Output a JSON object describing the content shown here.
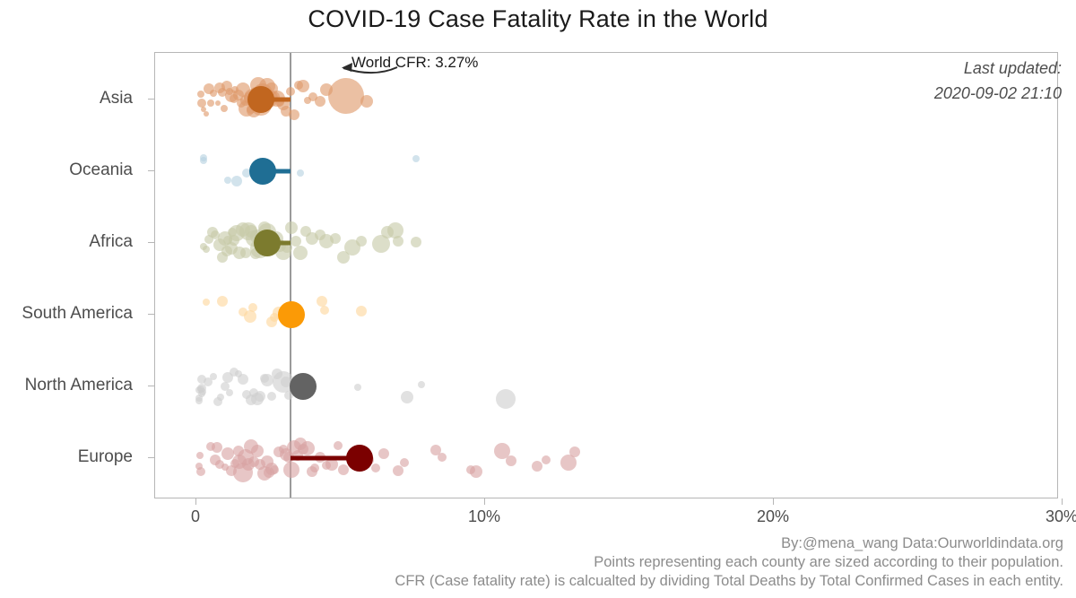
{
  "chart_data": {
    "type": "scatter",
    "title": "COVID-19 Case Fatality Rate in the World",
    "xlabel": "",
    "ylabel": "",
    "xlim": [
      -1.2,
      30.8
    ],
    "xticks": [
      0,
      10,
      20,
      30
    ],
    "xtick_labels": [
      "0",
      "10%",
      "20%",
      "30%"
    ],
    "grid": false,
    "legend": "none",
    "categories": [
      "Asia",
      "Oceania",
      "Africa",
      "South America",
      "North America",
      "Europe"
    ],
    "reference_line": {
      "label": "World CFR: 3.27%",
      "value": 3.27,
      "color": "#9a9a9a"
    },
    "series": [
      {
        "name": "Asia",
        "color": "#C1661F",
        "point_color": "#DE9A6B",
        "mean": 2.25,
        "points": [
          {
            "x": 0.35,
            "r": 3
          },
          {
            "x": 0.6,
            "r": 4
          },
          {
            "x": 0.75,
            "r": 3
          },
          {
            "x": 0.9,
            "r": 5
          },
          {
            "x": 1.05,
            "r": 6
          },
          {
            "x": 1.15,
            "r": 4
          },
          {
            "x": 1.2,
            "r": 7
          },
          {
            "x": 1.3,
            "r": 5
          },
          {
            "x": 1.35,
            "r": 4
          },
          {
            "x": 1.45,
            "r": 6
          },
          {
            "x": 0.45,
            "r": 6
          },
          {
            "x": 0.5,
            "r": 4
          },
          {
            "x": 0.2,
            "r": 5
          },
          {
            "x": 0.15,
            "r": 4
          },
          {
            "x": 0.8,
            "r": 6
          },
          {
            "x": 1.6,
            "r": 8
          },
          {
            "x": 1.7,
            "r": 6
          },
          {
            "x": 1.75,
            "r": 9
          },
          {
            "x": 1.85,
            "r": 7
          },
          {
            "x": 1.9,
            "r": 5
          },
          {
            "x": 1.95,
            "r": 10
          },
          {
            "x": 2.0,
            "r": 8
          },
          {
            "x": 2.05,
            "r": 6
          },
          {
            "x": 2.15,
            "r": 9
          },
          {
            "x": 2.2,
            "r": 7
          },
          {
            "x": 2.3,
            "r": 11
          },
          {
            "x": 2.35,
            "r": 6
          },
          {
            "x": 2.4,
            "r": 8
          },
          {
            "x": 2.5,
            "r": 10
          },
          {
            "x": 2.6,
            "r": 7
          },
          {
            "x": 2.7,
            "r": 6
          },
          {
            "x": 2.8,
            "r": 9
          },
          {
            "x": 2.9,
            "r": 5
          },
          {
            "x": 3.0,
            "r": 7
          },
          {
            "x": 3.1,
            "r": 6
          },
          {
            "x": 3.25,
            "r": 5
          },
          {
            "x": 3.4,
            "r": 6
          },
          {
            "x": 3.55,
            "r": 5
          },
          {
            "x": 3.7,
            "r": 7
          },
          {
            "x": 4.05,
            "r": 5
          },
          {
            "x": 4.3,
            "r": 6
          },
          {
            "x": 4.5,
            "r": 7
          },
          {
            "x": 5.2,
            "r": 20
          },
          {
            "x": 5.9,
            "r": 7
          },
          {
            "x": 2.25,
            "r": 12
          },
          {
            "x": 2.45,
            "r": 9
          },
          {
            "x": 1.55,
            "r": 5
          },
          {
            "x": 0.95,
            "r": 4
          },
          {
            "x": 0.25,
            "r": 3
          },
          {
            "x": 3.85,
            "r": 4
          }
        ]
      },
      {
        "name": "Oceania",
        "color": "#1F6E94",
        "point_color": "#B6D2E0",
        "mean": 2.3,
        "points": [
          {
            "x": 0.25,
            "r": 4
          },
          {
            "x": 0.25,
            "r": 4
          },
          {
            "x": 1.1,
            "r": 4
          },
          {
            "x": 1.4,
            "r": 6
          },
          {
            "x": 1.75,
            "r": 5
          },
          {
            "x": 3.6,
            "r": 4
          },
          {
            "x": 7.6,
            "r": 4
          }
        ]
      },
      {
        "name": "Africa",
        "color": "#7C7B2E",
        "point_color": "#C7C9A8",
        "mean": 2.45,
        "points": [
          {
            "x": 0.35,
            "r": 4
          },
          {
            "x": 0.55,
            "r": 6
          },
          {
            "x": 0.65,
            "r": 5
          },
          {
            "x": 0.8,
            "r": 7
          },
          {
            "x": 0.9,
            "r": 6
          },
          {
            "x": 1.0,
            "r": 8
          },
          {
            "x": 1.1,
            "r": 5
          },
          {
            "x": 1.2,
            "r": 7
          },
          {
            "x": 1.3,
            "r": 6
          },
          {
            "x": 1.4,
            "r": 9
          },
          {
            "x": 1.5,
            "r": 7
          },
          {
            "x": 1.6,
            "r": 8
          },
          {
            "x": 1.7,
            "r": 6
          },
          {
            "x": 1.8,
            "r": 10
          },
          {
            "x": 1.9,
            "r": 7
          },
          {
            "x": 2.0,
            "r": 9
          },
          {
            "x": 2.1,
            "r": 8
          },
          {
            "x": 2.2,
            "r": 11
          },
          {
            "x": 2.35,
            "r": 7
          },
          {
            "x": 2.5,
            "r": 9
          },
          {
            "x": 2.6,
            "r": 6
          },
          {
            "x": 2.75,
            "r": 8
          },
          {
            "x": 2.9,
            "r": 7
          },
          {
            "x": 3.0,
            "r": 9
          },
          {
            "x": 3.15,
            "r": 6
          },
          {
            "x": 3.3,
            "r": 7
          },
          {
            "x": 3.45,
            "r": 6
          },
          {
            "x": 3.6,
            "r": 8
          },
          {
            "x": 3.8,
            "r": 6
          },
          {
            "x": 4.0,
            "r": 7
          },
          {
            "x": 4.3,
            "r": 6
          },
          {
            "x": 4.5,
            "r": 8
          },
          {
            "x": 4.8,
            "r": 6
          },
          {
            "x": 5.1,
            "r": 7
          },
          {
            "x": 5.4,
            "r": 9
          },
          {
            "x": 5.7,
            "r": 6
          },
          {
            "x": 6.4,
            "r": 10
          },
          {
            "x": 6.6,
            "r": 7
          },
          {
            "x": 6.9,
            "r": 9
          },
          {
            "x": 7.0,
            "r": 6
          },
          {
            "x": 7.6,
            "r": 6
          },
          {
            "x": 0.25,
            "r": 4
          },
          {
            "x": 0.45,
            "r": 5
          },
          {
            "x": 1.05,
            "r": 6
          },
          {
            "x": 1.25,
            "r": 5
          },
          {
            "x": 2.45,
            "r": 10
          },
          {
            "x": 2.05,
            "r": 6
          }
        ]
      },
      {
        "name": "South America",
        "color": "#FB9A06",
        "point_color": "#FDD79C",
        "mean": 3.3,
        "points": [
          {
            "x": 0.35,
            "r": 4
          },
          {
            "x": 0.9,
            "r": 6
          },
          {
            "x": 1.6,
            "r": 5
          },
          {
            "x": 1.85,
            "r": 7
          },
          {
            "x": 1.95,
            "r": 5
          },
          {
            "x": 2.6,
            "r": 6
          },
          {
            "x": 2.7,
            "r": 5
          },
          {
            "x": 2.85,
            "r": 7
          },
          {
            "x": 3.0,
            "r": 6
          },
          {
            "x": 3.1,
            "r": 5
          },
          {
            "x": 4.35,
            "r": 6
          },
          {
            "x": 4.45,
            "r": 5
          },
          {
            "x": 5.7,
            "r": 6
          }
        ]
      },
      {
        "name": "North America",
        "color": "#636363",
        "point_color": "#CFCFCF",
        "mean": 3.7,
        "points": [
          {
            "x": 0.1,
            "r": 4
          },
          {
            "x": 0.1,
            "r": 4
          },
          {
            "x": 0.1,
            "r": 4
          },
          {
            "x": 0.15,
            "r": 4
          },
          {
            "x": 0.18,
            "r": 5
          },
          {
            "x": 0.2,
            "r": 5
          },
          {
            "x": 0.2,
            "r": 4
          },
          {
            "x": 0.22,
            "r": 4
          },
          {
            "x": 0.4,
            "r": 5
          },
          {
            "x": 0.6,
            "r": 4
          },
          {
            "x": 0.75,
            "r": 5
          },
          {
            "x": 0.85,
            "r": 4
          },
          {
            "x": 1.0,
            "r": 5
          },
          {
            "x": 1.1,
            "r": 6
          },
          {
            "x": 1.15,
            "r": 4
          },
          {
            "x": 1.3,
            "r": 5
          },
          {
            "x": 1.45,
            "r": 4
          },
          {
            "x": 1.6,
            "r": 6
          },
          {
            "x": 1.75,
            "r": 5
          },
          {
            "x": 1.9,
            "r": 6
          },
          {
            "x": 2.0,
            "r": 5
          },
          {
            "x": 2.1,
            "r": 7
          },
          {
            "x": 2.2,
            "r": 6
          },
          {
            "x": 2.35,
            "r": 5
          },
          {
            "x": 2.45,
            "r": 7
          },
          {
            "x": 2.6,
            "r": 5
          },
          {
            "x": 2.8,
            "r": 6
          },
          {
            "x": 3.0,
            "r": 12
          },
          {
            "x": 3.1,
            "r": 6
          },
          {
            "x": 3.2,
            "r": 5
          },
          {
            "x": 5.6,
            "r": 4
          },
          {
            "x": 7.3,
            "r": 7
          },
          {
            "x": 7.8,
            "r": 4
          },
          {
            "x": 10.7,
            "r": 11
          }
        ]
      },
      {
        "name": "Europe",
        "color": "#7B0000",
        "point_color": "#D9A3A3",
        "mean": 5.65,
        "points": [
          {
            "x": 0.1,
            "r": 4
          },
          {
            "x": 0.12,
            "r": 4
          },
          {
            "x": 0.15,
            "r": 5
          },
          {
            "x": 0.5,
            "r": 5
          },
          {
            "x": 0.65,
            "r": 6
          },
          {
            "x": 0.7,
            "r": 6
          },
          {
            "x": 0.8,
            "r": 5
          },
          {
            "x": 1.0,
            "r": 4
          },
          {
            "x": 1.1,
            "r": 7
          },
          {
            "x": 1.2,
            "r": 6
          },
          {
            "x": 1.35,
            "r": 5
          },
          {
            "x": 1.5,
            "r": 8
          },
          {
            "x": 1.6,
            "r": 11
          },
          {
            "x": 1.7,
            "r": 9
          },
          {
            "x": 1.8,
            "r": 7
          },
          {
            "x": 1.9,
            "r": 8
          },
          {
            "x": 2.0,
            "r": 6
          },
          {
            "x": 2.1,
            "r": 7
          },
          {
            "x": 2.2,
            "r": 6
          },
          {
            "x": 2.35,
            "r": 8
          },
          {
            "x": 2.5,
            "r": 6
          },
          {
            "x": 2.6,
            "r": 7
          },
          {
            "x": 2.7,
            "r": 5
          },
          {
            "x": 2.85,
            "r": 6
          },
          {
            "x": 3.0,
            "r": 5
          },
          {
            "x": 3.1,
            "r": 7
          },
          {
            "x": 3.2,
            "r": 6
          },
          {
            "x": 3.4,
            "r": 8
          },
          {
            "x": 3.5,
            "r": 6
          },
          {
            "x": 3.6,
            "r": 7
          },
          {
            "x": 3.7,
            "r": 6
          },
          {
            "x": 3.85,
            "r": 8
          },
          {
            "x": 4.0,
            "r": 6
          },
          {
            "x": 4.1,
            "r": 5
          },
          {
            "x": 4.3,
            "r": 6
          },
          {
            "x": 4.5,
            "r": 5
          },
          {
            "x": 4.7,
            "r": 7
          },
          {
            "x": 4.9,
            "r": 5
          },
          {
            "x": 5.1,
            "r": 6
          },
          {
            "x": 5.95,
            "r": 6
          },
          {
            "x": 6.2,
            "r": 5
          },
          {
            "x": 6.5,
            "r": 6
          },
          {
            "x": 7.0,
            "r": 6
          },
          {
            "x": 7.2,
            "r": 5
          },
          {
            "x": 8.3,
            "r": 6
          },
          {
            "x": 8.5,
            "r": 5
          },
          {
            "x": 9.5,
            "r": 5
          },
          {
            "x": 9.7,
            "r": 7
          },
          {
            "x": 10.6,
            "r": 9
          },
          {
            "x": 10.9,
            "r": 6
          },
          {
            "x": 11.8,
            "r": 6
          },
          {
            "x": 12.1,
            "r": 5
          },
          {
            "x": 12.9,
            "r": 9
          },
          {
            "x": 13.1,
            "r": 6
          },
          {
            "x": 3.3,
            "r": 9
          },
          {
            "x": 2.45,
            "r": 7
          },
          {
            "x": 1.45,
            "r": 6
          }
        ]
      }
    ]
  },
  "annotations": {
    "world_cfr_note": "World CFR: 3.27%",
    "last_updated_label": "Last updated:",
    "last_updated_value": "2020-09-02 21:10"
  },
  "captions": {
    "credit": "By:@mena_wang  Data:Ourworldindata.org",
    "note_points": "Points representing each county are sized according to their population.",
    "note_cfr": "CFR (Case fatality rate) is calcualted by dividing Total Deaths by Total Confirmed Cases in each entity."
  }
}
